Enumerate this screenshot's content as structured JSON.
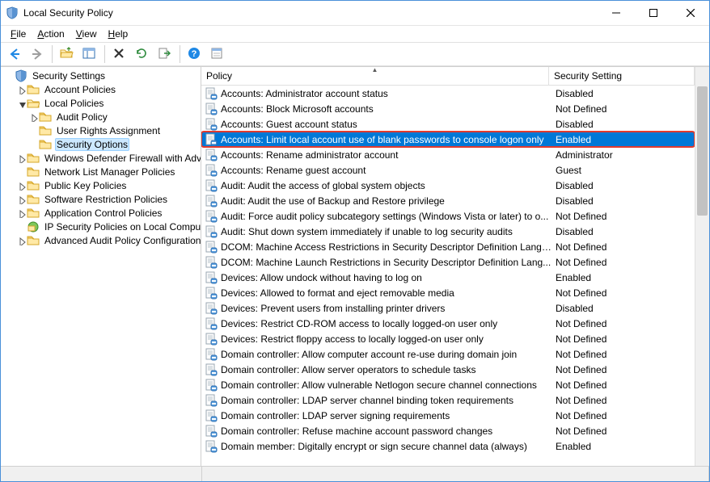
{
  "window": {
    "title": "Local Security Policy"
  },
  "menu": {
    "file": "File",
    "action": "Action",
    "view": "View",
    "help": "Help"
  },
  "tree": {
    "root": "Security Settings",
    "items": [
      {
        "label": "Account Policies",
        "depth": 1,
        "expandable": true,
        "expanded": false
      },
      {
        "label": "Local Policies",
        "depth": 1,
        "expandable": true,
        "expanded": true
      },
      {
        "label": "Audit Policy",
        "depth": 2,
        "expandable": true,
        "expanded": false
      },
      {
        "label": "User Rights Assignment",
        "depth": 2,
        "expandable": false
      },
      {
        "label": "Security Options",
        "depth": 2,
        "expandable": false,
        "selected": true
      },
      {
        "label": "Windows Defender Firewall with Advanced Security",
        "depth": 1,
        "expandable": true,
        "expanded": false
      },
      {
        "label": "Network List Manager Policies",
        "depth": 1,
        "expandable": false
      },
      {
        "label": "Public Key Policies",
        "depth": 1,
        "expandable": true,
        "expanded": false
      },
      {
        "label": "Software Restriction Policies",
        "depth": 1,
        "expandable": true,
        "expanded": false
      },
      {
        "label": "Application Control Policies",
        "depth": 1,
        "expandable": true,
        "expanded": false
      },
      {
        "label": "IP Security Policies on Local Computer",
        "depth": 1,
        "expandable": false,
        "icon": "ipsec"
      },
      {
        "label": "Advanced Audit Policy Configuration",
        "depth": 1,
        "expandable": true,
        "expanded": false
      }
    ]
  },
  "list": {
    "col_policy": "Policy",
    "col_setting": "Security Setting",
    "rows": [
      {
        "policy": "Accounts: Administrator account status",
        "setting": "Disabled"
      },
      {
        "policy": "Accounts: Block Microsoft accounts",
        "setting": "Not Defined"
      },
      {
        "policy": "Accounts: Guest account status",
        "setting": "Disabled"
      },
      {
        "policy": "Accounts: Limit local account use of blank passwords to console logon only",
        "setting": "Enabled",
        "selected": true,
        "highlight": true
      },
      {
        "policy": "Accounts: Rename administrator account",
        "setting": "Administrator"
      },
      {
        "policy": "Accounts: Rename guest account",
        "setting": "Guest"
      },
      {
        "policy": "Audit: Audit the access of global system objects",
        "setting": "Disabled"
      },
      {
        "policy": "Audit: Audit the use of Backup and Restore privilege",
        "setting": "Disabled"
      },
      {
        "policy": "Audit: Force audit policy subcategory settings (Windows Vista or later) to o...",
        "setting": "Not Defined"
      },
      {
        "policy": "Audit: Shut down system immediately if unable to log security audits",
        "setting": "Disabled"
      },
      {
        "policy": "DCOM: Machine Access Restrictions in Security Descriptor Definition Langu...",
        "setting": "Not Defined"
      },
      {
        "policy": "DCOM: Machine Launch Restrictions in Security Descriptor Definition Lang...",
        "setting": "Not Defined"
      },
      {
        "policy": "Devices: Allow undock without having to log on",
        "setting": "Enabled"
      },
      {
        "policy": "Devices: Allowed to format and eject removable media",
        "setting": "Not Defined"
      },
      {
        "policy": "Devices: Prevent users from installing printer drivers",
        "setting": "Disabled"
      },
      {
        "policy": "Devices: Restrict CD-ROM access to locally logged-on user only",
        "setting": "Not Defined"
      },
      {
        "policy": "Devices: Restrict floppy access to locally logged-on user only",
        "setting": "Not Defined"
      },
      {
        "policy": "Domain controller: Allow computer account re-use during domain join",
        "setting": "Not Defined"
      },
      {
        "policy": "Domain controller: Allow server operators to schedule tasks",
        "setting": "Not Defined"
      },
      {
        "policy": "Domain controller: Allow vulnerable Netlogon secure channel connections",
        "setting": "Not Defined"
      },
      {
        "policy": "Domain controller: LDAP server channel binding token requirements",
        "setting": "Not Defined"
      },
      {
        "policy": "Domain controller: LDAP server signing requirements",
        "setting": "Not Defined"
      },
      {
        "policy": "Domain controller: Refuse machine account password changes",
        "setting": "Not Defined"
      },
      {
        "policy": "Domain member: Digitally encrypt or sign secure channel data (always)",
        "setting": "Enabled"
      }
    ]
  }
}
